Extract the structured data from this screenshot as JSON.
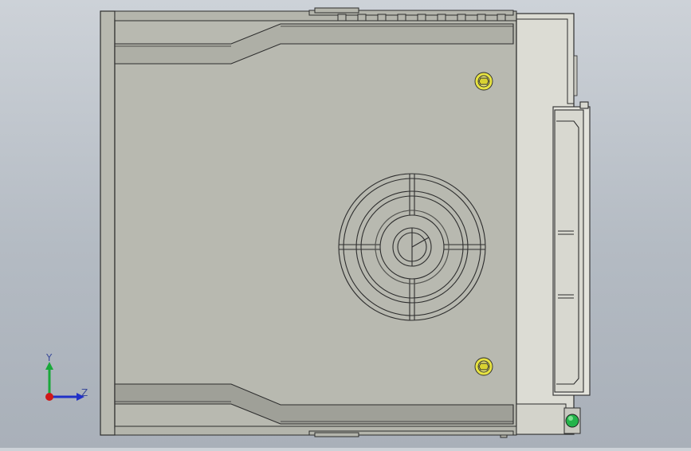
{
  "viewport": {
    "background_top": "#cdd2d8",
    "background_bottom": "#a9b0b9"
  },
  "model": {
    "housing_color": "#b4b5ac",
    "face_color": "#b8b9b0",
    "edge_color": "#2d2d2d",
    "screw_color": "#e9e44a"
  },
  "triad": {
    "y_label": "Y",
    "z_label": "Z",
    "y_color": "#19a83a",
    "z_color": "#2030c8",
    "x_color": "#d01818"
  }
}
